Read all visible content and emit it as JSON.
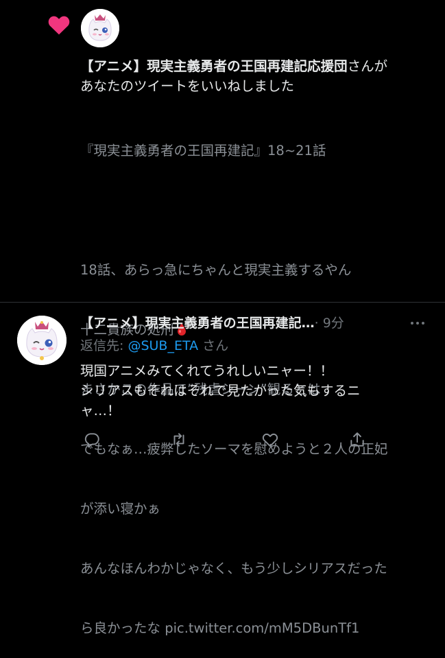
{
  "notification": {
    "account_name": "【アニメ】現実主義勇者の王国再建記応援団",
    "action_line1": "さんが",
    "action_line2": "あなたのツイートをいいねしました"
  },
  "liked_tweet": {
    "lines": [
      "『現実主義勇者の王国再建記』18~21話",
      "",
      "18話、あらっ急にちゃんと現実主義するやん",
      "十二貴族の処刑",
      "まさかこの作品で”残虐シーン”観るとは",
      "でもなぁ…疲弊したソーマを慰めようと２人の正妃",
      "が添い寝かぁ",
      "あんなほんわかじゃなく、もう少しシリアスだった",
      "ら良かったな pic.twitter.com/mM5DBunTf1"
    ],
    "emoji": "blood-drop-icon"
  },
  "reply_tweet": {
    "display_name": "【アニメ】現実主義勇者の王国再建記…",
    "time": "· 9分",
    "reply_prefix": "返信先: ",
    "reply_handle": "@SUB_ETA",
    "reply_suffix": " さん",
    "lines": [
      "現国アニメみてくれてうれしいニャー！！",
      "シリアスもそれはそれで見たかった気もするニ",
      "ャ…！"
    ],
    "actions": [
      "reply-icon",
      "retweet-icon",
      "like-icon",
      "share-icon"
    ]
  },
  "colors": {
    "background": "#000000",
    "text": "#e7e9ea",
    "muted": "#8b9096",
    "link": "#1d9bf0",
    "heart": "#f91880",
    "drop": "#e0242a"
  }
}
